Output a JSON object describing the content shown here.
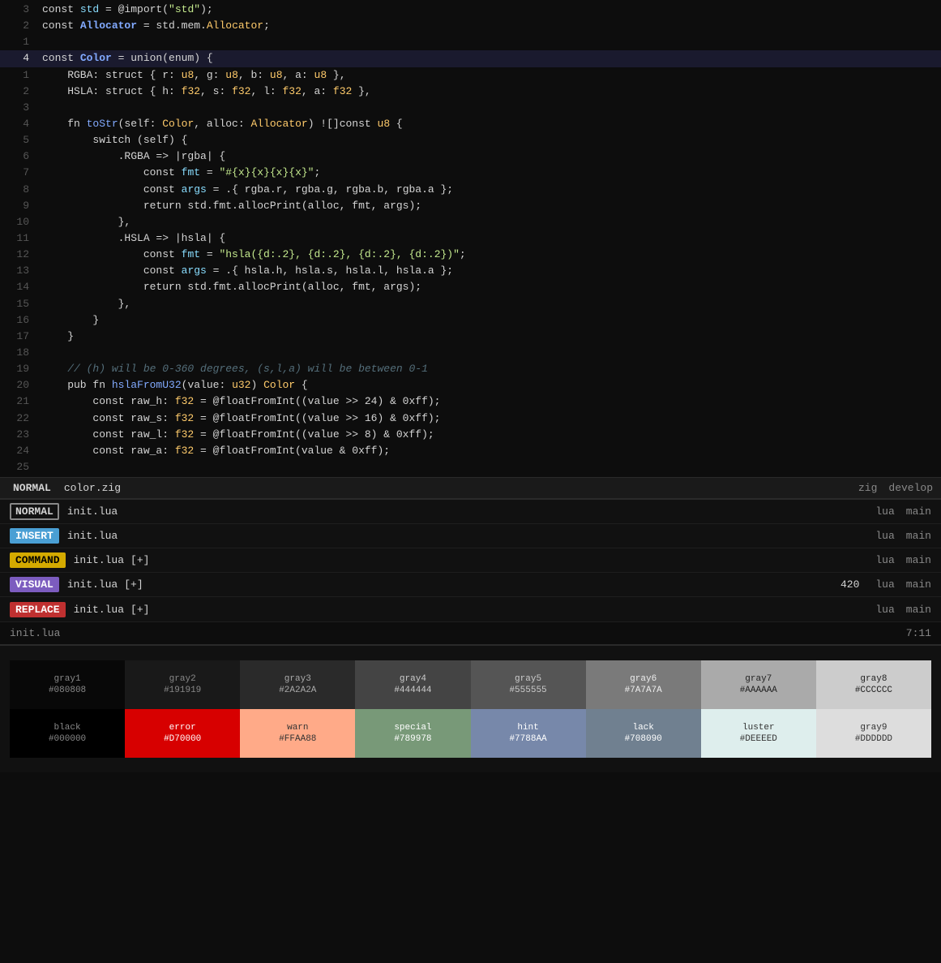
{
  "editor": {
    "lines": [
      {
        "num": "3",
        "active": false,
        "highlighted": false,
        "tokens": [
          {
            "t": "plain",
            "v": "const "
          },
          {
            "t": "kw",
            "v": "std"
          },
          {
            "t": "plain",
            "v": " = @import("
          },
          {
            "t": "str",
            "v": "\"std\""
          },
          {
            "t": "plain",
            "v": ");"
          }
        ]
      },
      {
        "num": "2",
        "active": false,
        "highlighted": false,
        "tokens": [
          {
            "t": "plain",
            "v": "const "
          },
          {
            "t": "bold-kw",
            "v": "Allocator"
          },
          {
            "t": "plain",
            "v": " = std.mem."
          },
          {
            "t": "type",
            "v": "Allocator"
          },
          {
            "t": "plain",
            "v": ";"
          }
        ]
      },
      {
        "num": "1",
        "active": false,
        "highlighted": false,
        "tokens": []
      },
      {
        "num": "4",
        "active": true,
        "highlighted": true,
        "tokens": [
          {
            "t": "plain",
            "v": "const "
          },
          {
            "t": "bold-kw",
            "v": "Color"
          },
          {
            "t": "plain",
            "v": " = union(enum) {"
          }
        ]
      },
      {
        "num": "1",
        "active": false,
        "highlighted": false,
        "tokens": [
          {
            "t": "plain",
            "v": "    RGBA: struct { r: "
          },
          {
            "t": "type",
            "v": "u8"
          },
          {
            "t": "plain",
            "v": ", g: "
          },
          {
            "t": "type",
            "v": "u8"
          },
          {
            "t": "plain",
            "v": ", b: "
          },
          {
            "t": "type",
            "v": "u8"
          },
          {
            "t": "plain",
            "v": ", a: "
          },
          {
            "t": "type",
            "v": "u8"
          },
          {
            "t": "plain",
            "v": " },"
          }
        ]
      },
      {
        "num": "2",
        "active": false,
        "highlighted": false,
        "tokens": [
          {
            "t": "plain",
            "v": "    HSLA: struct { h: "
          },
          {
            "t": "type",
            "v": "f32"
          },
          {
            "t": "plain",
            "v": ", s: "
          },
          {
            "t": "type",
            "v": "f32"
          },
          {
            "t": "plain",
            "v": ", l: "
          },
          {
            "t": "type",
            "v": "f32"
          },
          {
            "t": "plain",
            "v": ", a: "
          },
          {
            "t": "type",
            "v": "f32"
          },
          {
            "t": "plain",
            "v": " },"
          }
        ]
      },
      {
        "num": "3",
        "active": false,
        "highlighted": false,
        "tokens": []
      },
      {
        "num": "4",
        "active": false,
        "highlighted": false,
        "tokens": [
          {
            "t": "plain",
            "v": "    fn "
          },
          {
            "t": "fn-name",
            "v": "toStr"
          },
          {
            "t": "plain",
            "v": "(self: "
          },
          {
            "t": "type",
            "v": "Color"
          },
          {
            "t": "plain",
            "v": ", alloc: "
          },
          {
            "t": "type",
            "v": "Allocator"
          },
          {
            "t": "plain",
            "v": ") ![]const "
          },
          {
            "t": "type",
            "v": "u8"
          },
          {
            "t": "plain",
            "v": " {"
          }
        ]
      },
      {
        "num": "5",
        "active": false,
        "highlighted": false,
        "tokens": [
          {
            "t": "plain",
            "v": "        switch (self) {"
          }
        ]
      },
      {
        "num": "6",
        "active": false,
        "highlighted": false,
        "tokens": [
          {
            "t": "plain",
            "v": "            .RGBA => |rgba| {"
          }
        ]
      },
      {
        "num": "7",
        "active": false,
        "highlighted": false,
        "tokens": [
          {
            "t": "plain",
            "v": "                const "
          },
          {
            "t": "kw",
            "v": "fmt"
          },
          {
            "t": "plain",
            "v": " = "
          },
          {
            "t": "str",
            "v": "\"#{x}{x}{x}{x}\""
          },
          {
            "t": "plain",
            "v": ";"
          }
        ]
      },
      {
        "num": "8",
        "active": false,
        "highlighted": false,
        "tokens": [
          {
            "t": "plain",
            "v": "                const "
          },
          {
            "t": "kw",
            "v": "args"
          },
          {
            "t": "plain",
            "v": " = .{ rgba.r, rgba.g, rgba.b, rgba.a };"
          }
        ]
      },
      {
        "num": "9",
        "active": false,
        "highlighted": false,
        "tokens": [
          {
            "t": "plain",
            "v": "                return std.fmt.allocPrint(alloc, fmt, args);"
          }
        ]
      },
      {
        "num": "10",
        "active": false,
        "highlighted": false,
        "tokens": [
          {
            "t": "plain",
            "v": "            },"
          }
        ]
      },
      {
        "num": "11",
        "active": false,
        "highlighted": false,
        "tokens": [
          {
            "t": "plain",
            "v": "            .HSLA => |hsla| {"
          }
        ]
      },
      {
        "num": "12",
        "active": false,
        "highlighted": false,
        "tokens": [
          {
            "t": "plain",
            "v": "                const "
          },
          {
            "t": "kw",
            "v": "fmt"
          },
          {
            "t": "plain",
            "v": " = "
          },
          {
            "t": "str",
            "v": "\"hsla({d:.2}, {d:.2}, {d:.2}, {d:.2})\""
          },
          {
            "t": "plain",
            "v": ";"
          }
        ]
      },
      {
        "num": "13",
        "active": false,
        "highlighted": false,
        "tokens": [
          {
            "t": "plain",
            "v": "                const "
          },
          {
            "t": "kw",
            "v": "args"
          },
          {
            "t": "plain",
            "v": " = .{ hsla.h, hsla.s, hsla.l, hsla.a };"
          }
        ]
      },
      {
        "num": "14",
        "active": false,
        "highlighted": false,
        "tokens": [
          {
            "t": "plain",
            "v": "                return std.fmt.allocPrint(alloc, fmt, args);"
          }
        ]
      },
      {
        "num": "15",
        "active": false,
        "highlighted": false,
        "tokens": [
          {
            "t": "plain",
            "v": "            },"
          }
        ]
      },
      {
        "num": "16",
        "active": false,
        "highlighted": false,
        "tokens": [
          {
            "t": "plain",
            "v": "        }"
          }
        ]
      },
      {
        "num": "17",
        "active": false,
        "highlighted": false,
        "tokens": [
          {
            "t": "plain",
            "v": "    }"
          }
        ]
      },
      {
        "num": "18",
        "active": false,
        "highlighted": false,
        "tokens": []
      },
      {
        "num": "19",
        "active": false,
        "highlighted": false,
        "tokens": [
          {
            "t": "comment",
            "v": "    // (h) will be 0-360 degrees, (s,l,a) will be between 0-1"
          }
        ]
      },
      {
        "num": "20",
        "active": false,
        "highlighted": false,
        "tokens": [
          {
            "t": "plain",
            "v": "    pub fn "
          },
          {
            "t": "fn-name",
            "v": "hslaFromU32"
          },
          {
            "t": "plain",
            "v": "(value: "
          },
          {
            "t": "type",
            "v": "u32"
          },
          {
            "t": "plain",
            "v": ") "
          },
          {
            "t": "type",
            "v": "Color"
          },
          {
            "t": "plain",
            "v": " {"
          }
        ]
      },
      {
        "num": "21",
        "active": false,
        "highlighted": false,
        "tokens": [
          {
            "t": "plain",
            "v": "        const raw_h: "
          },
          {
            "t": "type",
            "v": "f32"
          },
          {
            "t": "plain",
            "v": " = @floatFromInt((value >> 24) & 0xff);"
          }
        ]
      },
      {
        "num": "22",
        "active": false,
        "highlighted": false,
        "tokens": [
          {
            "t": "plain",
            "v": "        const raw_s: "
          },
          {
            "t": "type",
            "v": "f32"
          },
          {
            "t": "plain",
            "v": " = @floatFromInt((value >> 16) & 0xff);"
          }
        ]
      },
      {
        "num": "23",
        "active": false,
        "highlighted": false,
        "tokens": [
          {
            "t": "plain",
            "v": "        const raw_l: "
          },
          {
            "t": "type",
            "v": "f32"
          },
          {
            "t": "plain",
            "v": " = @floatFromInt((value >> 8) & 0xff);"
          }
        ]
      },
      {
        "num": "24",
        "active": false,
        "highlighted": false,
        "tokens": [
          {
            "t": "plain",
            "v": "        const raw_a: "
          },
          {
            "t": "type",
            "v": "f32"
          },
          {
            "t": "plain",
            "v": " = @floatFromInt(value & 0xff);"
          }
        ]
      },
      {
        "num": "25",
        "active": false,
        "highlighted": false,
        "tokens": []
      }
    ],
    "status": {
      "mode": "NORMAL",
      "filename": "color.zig",
      "lang": "zig",
      "branch": "develop"
    }
  },
  "statuslines": [
    {
      "mode": "NORMAL",
      "mode_style": "normal",
      "filename": "init.lua",
      "modified": "",
      "count": "",
      "lang": "lua",
      "branch": "main"
    },
    {
      "mode": "INSERT",
      "mode_style": "insert",
      "filename": "init.lua",
      "modified": "",
      "count": "",
      "lang": "lua",
      "branch": "main"
    },
    {
      "mode": "COMMAND",
      "mode_style": "command",
      "filename": "init.lua",
      "modified": "[+]",
      "count": "",
      "lang": "lua",
      "branch": "main"
    },
    {
      "mode": "VISUAL",
      "mode_style": "visual",
      "filename": "init.lua",
      "modified": "[+]",
      "count": "420",
      "lang": "lua",
      "branch": "main"
    },
    {
      "mode": "REPLACE",
      "mode_style": "replace",
      "filename": "init.lua",
      "modified": "[+]",
      "count": "",
      "lang": "lua",
      "branch": "main"
    }
  ],
  "terminal_line": {
    "filename": "init.lua",
    "position": "7:11"
  },
  "palette": {
    "row1": [
      {
        "name": "gray1",
        "hex": "#080808",
        "bg": "#080808",
        "fg": "#888888"
      },
      {
        "name": "gray2",
        "hex": "#191919",
        "bg": "#191919",
        "fg": "#888888"
      },
      {
        "name": "gray3",
        "hex": "#2A2A2A",
        "bg": "#2A2A2A",
        "fg": "#aaaaaa"
      },
      {
        "name": "gray4",
        "hex": "#444444",
        "bg": "#444444",
        "fg": "#cccccc"
      },
      {
        "name": "gray5",
        "hex": "#555555",
        "bg": "#555555",
        "fg": "#cccccc"
      },
      {
        "name": "gray6",
        "hex": "#7A7A7A",
        "bg": "#7A7A7A",
        "fg": "#eeeeee"
      },
      {
        "name": "gray7",
        "hex": "#AAAAAA",
        "bg": "#AAAAAA",
        "fg": "#222222"
      },
      {
        "name": "gray8",
        "hex": "#CCCCCC",
        "bg": "#CCCCCC",
        "fg": "#222222"
      }
    ],
    "row2": [
      {
        "name": "black",
        "hex": "#000000",
        "bg": "#000000",
        "fg": "#888888"
      },
      {
        "name": "error",
        "hex": "#D70000",
        "bg": "#D70000",
        "fg": "#ffffff"
      },
      {
        "name": "warn",
        "hex": "#FFAA88",
        "bg": "#FFAA88",
        "fg": "#333333"
      },
      {
        "name": "special",
        "hex": "#789978",
        "bg": "#789978",
        "fg": "#ffffff"
      },
      {
        "name": "hint",
        "hex": "#7788AA",
        "bg": "#7788AA",
        "fg": "#ffffff"
      },
      {
        "name": "lack",
        "hex": "#708090",
        "bg": "#708090",
        "fg": "#ffffff"
      },
      {
        "name": "luster",
        "hex": "#DEEEED",
        "bg": "#DEEEED",
        "fg": "#333333"
      },
      {
        "name": "gray9",
        "hex": "#DDDDDD",
        "bg": "#DDDDDD",
        "fg": "#333333"
      }
    ]
  }
}
